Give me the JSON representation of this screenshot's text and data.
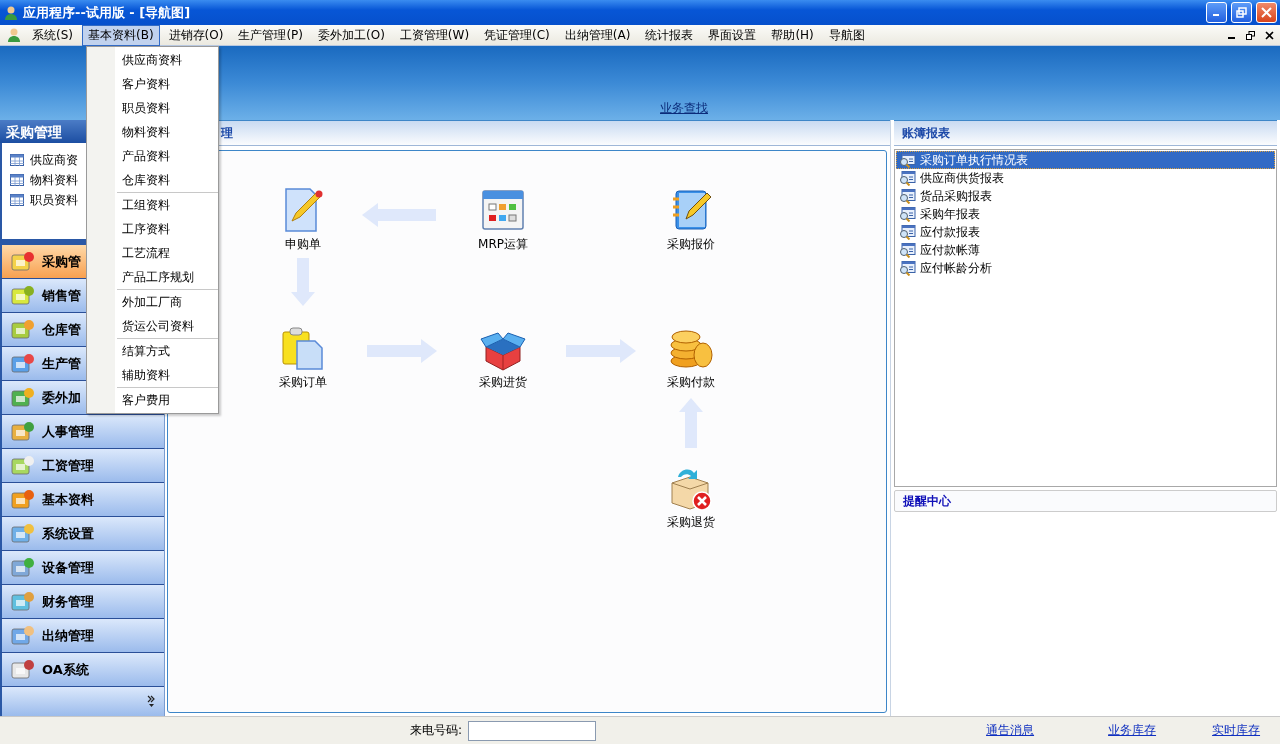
{
  "window": {
    "title": "应用程序--试用版 - [导航图]"
  },
  "menu_bar": {
    "items": [
      {
        "label": "系统(S)",
        "selected": false
      },
      {
        "label": "基本资料(B)",
        "selected": true
      },
      {
        "label": "进销存(O)",
        "selected": false
      },
      {
        "label": "生产管理(P)",
        "selected": false
      },
      {
        "label": "委外加工(O)",
        "selected": false
      },
      {
        "label": "工资管理(W)",
        "selected": false
      },
      {
        "label": "凭证管理(C)",
        "selected": false
      },
      {
        "label": "出纳管理(A)",
        "selected": false
      },
      {
        "label": "统计报表",
        "selected": false
      },
      {
        "label": "界面设置",
        "selected": false
      },
      {
        "label": "帮助(H)",
        "selected": false
      },
      {
        "label": "导航图",
        "selected": false
      }
    ]
  },
  "open_menu": {
    "groups": [
      {
        "items": [
          "供应商资料",
          "客户资料",
          "职员资料",
          "物料资料",
          "产品资料",
          "仓库资料"
        ]
      },
      {
        "items": [
          "工组资料",
          "工序资料",
          "工艺流程",
          "产品工序规划"
        ]
      },
      {
        "items": [
          "外加工厂商",
          "货运公司资料"
        ]
      },
      {
        "items": [
          "结算方式",
          "辅助资料"
        ]
      },
      {
        "items": [
          "客户费用"
        ]
      }
    ]
  },
  "banner": {
    "link": "业务查找"
  },
  "left_panel": {
    "title": "采购管理",
    "tree": [
      "供应商资",
      "物料资料",
      "职员资料"
    ],
    "modules": [
      {
        "label": "采购管",
        "selected": true
      },
      {
        "label": "销售管",
        "selected": false
      },
      {
        "label": "仓库管",
        "selected": false
      },
      {
        "label": "生产管",
        "selected": false
      },
      {
        "label": "委外加",
        "selected": false
      },
      {
        "label": "人事管理",
        "selected": false
      },
      {
        "label": "工资管理",
        "selected": false
      },
      {
        "label": "基本资料",
        "selected": false
      },
      {
        "label": "系统设置",
        "selected": false
      },
      {
        "label": "设备管理",
        "selected": false
      },
      {
        "label": "财务管理",
        "selected": false
      },
      {
        "label": "出纳管理",
        "selected": false
      },
      {
        "label": "OA系统",
        "selected": false
      }
    ]
  },
  "center_panel": {
    "title": "理",
    "nodes": [
      {
        "label": "申购单",
        "kind": "requisition"
      },
      {
        "label": "MRP运算",
        "kind": "mrp"
      },
      {
        "label": "采购报价",
        "kind": "quote"
      },
      {
        "label": "采购订单",
        "kind": "order"
      },
      {
        "label": "采购进货",
        "kind": "receive"
      },
      {
        "label": "采购付款",
        "kind": "payment"
      },
      {
        "label": "采购退货",
        "kind": "return"
      }
    ]
  },
  "right_panel": {
    "title": "账簿报表",
    "reports": [
      {
        "label": "采购订单执行情况表",
        "selected": true
      },
      {
        "label": "供应商供货报表",
        "selected": false
      },
      {
        "label": "货品采购报表",
        "selected": false
      },
      {
        "label": "采购年报表",
        "selected": false
      },
      {
        "label": "应付款报表",
        "selected": false
      },
      {
        "label": "应付款帐薄",
        "selected": false
      },
      {
        "label": "应付帐龄分析",
        "selected": false
      }
    ],
    "reminder_title": "提醒中心"
  },
  "status_bar": {
    "phone_label": "来电号码:",
    "links": [
      "通告消息",
      "业务库存",
      "实时库存"
    ]
  }
}
